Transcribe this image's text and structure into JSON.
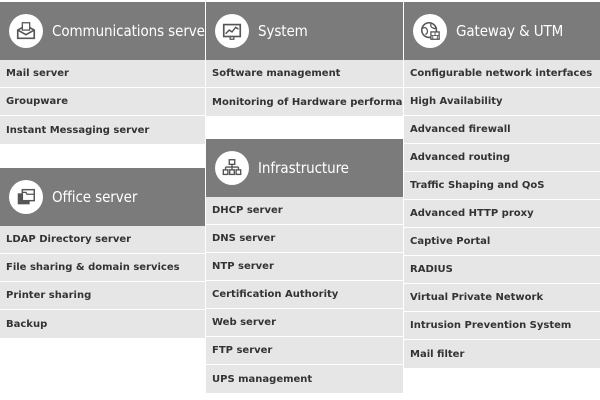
{
  "colors": {
    "header_bg": "#7b7b7b",
    "row_bg": "#e6e6e6",
    "text": "#333333",
    "header_text": "#ffffff"
  },
  "communications": {
    "title": "Communications server",
    "icon": "envelope-icon",
    "items": [
      "Mail server",
      "Groupware",
      "Instant Messaging server"
    ]
  },
  "office": {
    "title": "Office server",
    "icon": "folders-icon",
    "items": [
      "LDAP Directory server",
      "File sharing & domain services",
      "Printer sharing",
      "Backup"
    ]
  },
  "system": {
    "title": "System",
    "icon": "monitor-chart-icon",
    "items": [
      "Software management",
      "Monitoring of Hardware performance"
    ]
  },
  "infrastructure": {
    "title": "Infrastructure",
    "icon": "network-icon",
    "items": [
      "DHCP server",
      "DNS server",
      "NTP server",
      "Certification Authority",
      "Web server",
      "FTP server",
      "UPS management"
    ]
  },
  "gateway": {
    "title": "Gateway & UTM",
    "icon": "globe-firewall-icon",
    "items": [
      "Configurable network interfaces",
      "High Availability",
      "Advanced firewall",
      "Advanced routing",
      "Traffic Shaping and QoS",
      "Advanced HTTP proxy",
      "Captive Portal",
      "RADIUS",
      "Virtual Private Network",
      "Intrusion Prevention System",
      "Mail filter"
    ]
  }
}
